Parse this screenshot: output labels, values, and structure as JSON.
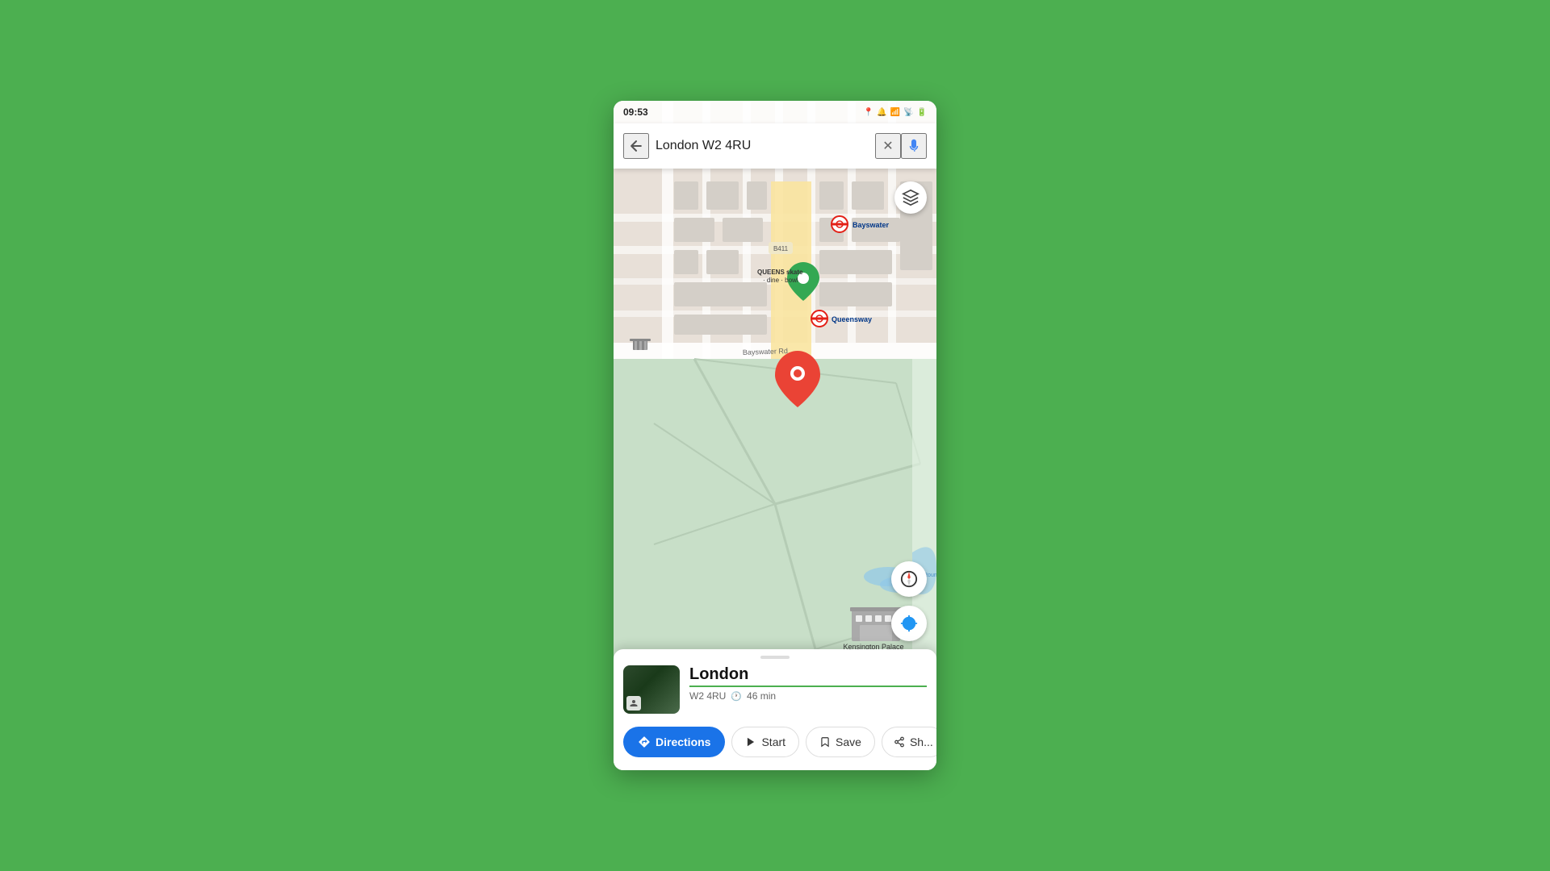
{
  "statusBar": {
    "time": "09:53",
    "icons": [
      "location",
      "volume",
      "wifi",
      "signal",
      "battery"
    ]
  },
  "searchBar": {
    "query": "London W2 4RU",
    "backLabel": "←",
    "clearLabel": "✕",
    "micLabel": "🎤"
  },
  "map": {
    "center": "Kensington Gardens, London W2 4RU",
    "labels": {
      "bayswater": "Bayswater",
      "queensSkate": "QUEENS skate · dine · bowl",
      "queensway": "Queensway",
      "kensingtonPalace": "Kensington Palace",
      "bayswaterRd": "Bayswater Rd",
      "road411": "B411"
    }
  },
  "bottomPanel": {
    "placeName": "London",
    "placeSubtitle": "W2 4RU",
    "travelTime": "46 min",
    "handle": ""
  },
  "actionButtons": {
    "directions": "Directions",
    "start": "Start",
    "save": "Save",
    "share": "Sh..."
  }
}
